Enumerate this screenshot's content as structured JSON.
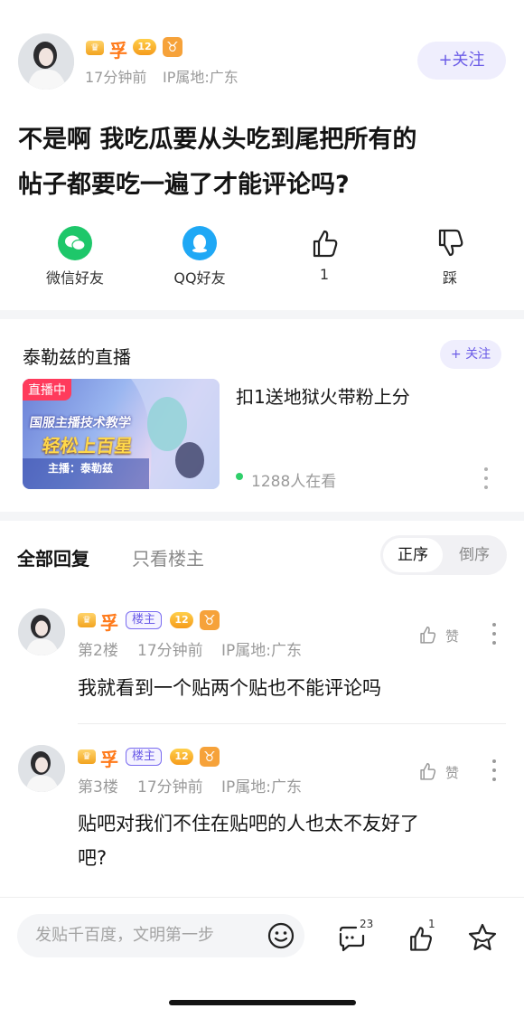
{
  "author": {
    "name": "孚",
    "level": "12",
    "zodiac": "♉",
    "time": "17分钟前",
    "ip": "IP属地:广东",
    "follow_label": "+关注"
  },
  "post": {
    "title_line1": "不是啊 我吃瓜要从头吃到尾把所有的",
    "title_line2": "帖子都要吃一遍了才能评论吗?"
  },
  "actions": {
    "wechat": "微信好友",
    "qq": "QQ好友",
    "like_count": "1",
    "dislike": "踩"
  },
  "live": {
    "section_title": "泰勒兹的直播",
    "follow_label": "+ 关注",
    "badge": "直播中",
    "thumb_line1": "国服主播技术教学",
    "thumb_line2": "轻松上百星",
    "thumb_host": "主播：泰勒兹",
    "title": "扣1送地狱火带粉上分",
    "viewers": "1288人在看"
  },
  "tabs": {
    "all": "全部回复",
    "op_only": "只看楼主",
    "sort_asc": "正序",
    "sort_desc": "倒序"
  },
  "replies": [
    {
      "name": "孚",
      "tag": "楼主",
      "level": "12",
      "floor": "第2楼",
      "time": "17分钟前",
      "ip": "IP属地:广东",
      "like_label": "赞",
      "text_line1": "我就看到一个贴两个贴也不能评论吗",
      "text_line2": ""
    },
    {
      "name": "孚",
      "tag": "楼主",
      "level": "12",
      "floor": "第3楼",
      "time": "17分钟前",
      "ip": "IP属地:广东",
      "like_label": "赞",
      "text_line1": "贴吧对我们不住在贴吧的人也太不友好了",
      "text_line2": "吧?"
    }
  ],
  "bottom": {
    "placeholder": "发贴千百度，文明第一步",
    "comment_count": "23",
    "like_count": "1"
  },
  "colors": {
    "accent": "#6b5ce7",
    "name": "#ff7a1a",
    "wechat": "#1ec76a",
    "qq": "#1fa8f5",
    "live_badge": "#ff3b5c"
  }
}
